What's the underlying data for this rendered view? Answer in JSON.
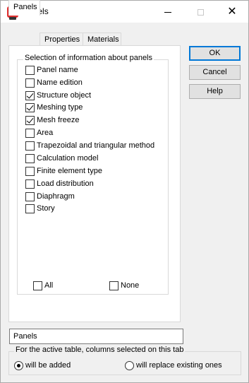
{
  "window": {
    "title": "Panels",
    "app_icon_letter": "R"
  },
  "tabs": [
    {
      "label": "Panels",
      "active": true
    },
    {
      "label": "Properties",
      "active": false
    },
    {
      "label": "Materials",
      "active": false
    }
  ],
  "selection_group": {
    "legend": "Selection of information about panels",
    "items": [
      {
        "label": "Panel name",
        "checked": false
      },
      {
        "label": "Name edition",
        "checked": false
      },
      {
        "label": "Structure object",
        "checked": true
      },
      {
        "label": "Meshing type",
        "checked": true
      },
      {
        "label": "Mesh freeze",
        "checked": true
      },
      {
        "label": "Area",
        "checked": false
      },
      {
        "label": "Trapezoidal and triangular method",
        "checked": false
      },
      {
        "label": "Calculation model",
        "checked": false
      },
      {
        "label": "Finite element type",
        "checked": false
      },
      {
        "label": "Load distribution",
        "checked": false
      },
      {
        "label": "Diaphragm",
        "checked": false
      },
      {
        "label": "Story",
        "checked": false
      }
    ],
    "all_label": "All",
    "none_label": "None"
  },
  "buttons": {
    "ok": "OK",
    "cancel": "Cancel",
    "help": "Help"
  },
  "table_name": "Panels",
  "columns_group": {
    "legend": "For the active table, columns selected on this tab",
    "option_added": "will be added",
    "option_replace": "will replace existing ones",
    "selected": "added"
  }
}
